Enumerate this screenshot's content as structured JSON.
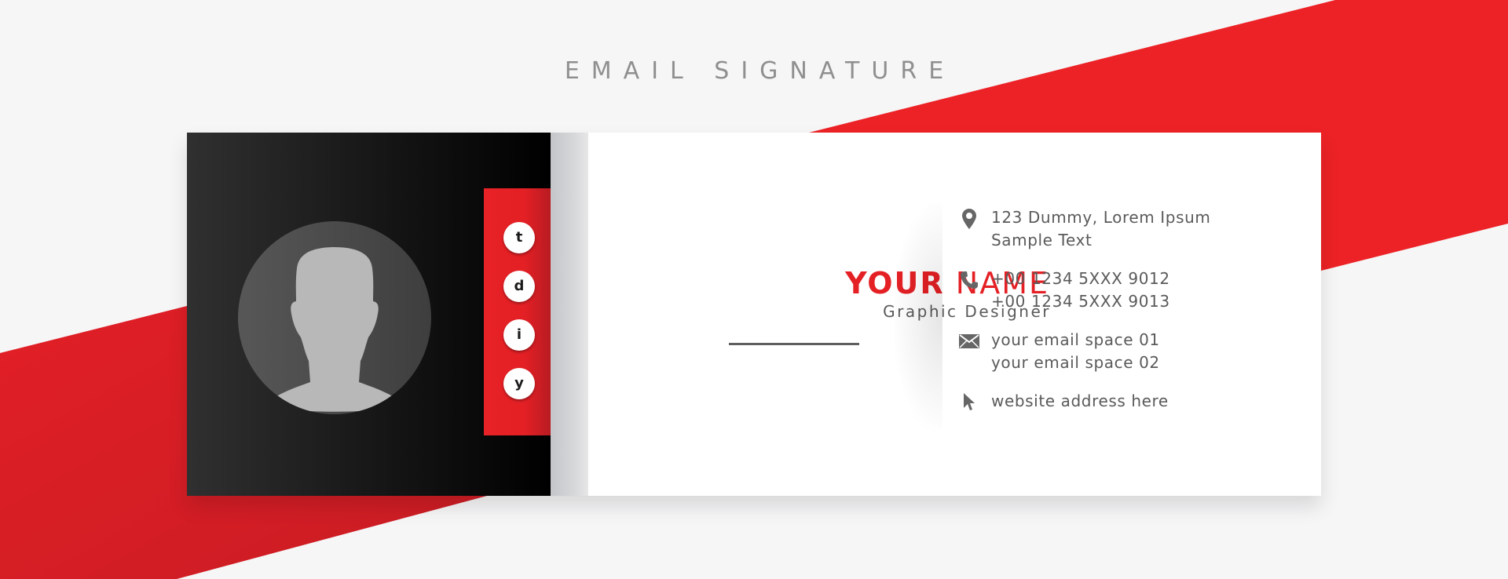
{
  "headline": "EMAIL SIGNATURE",
  "colors": {
    "accent_red": "#e42025",
    "dark_panel": "#111111",
    "text_gray": "#5a5a5a",
    "headline_gray": "#8f8f8f",
    "background": "#f6f6f7"
  },
  "profile": {
    "avatar_icon": "user-silhouette-icon",
    "first_name": "YOUR",
    "last_name": "NAME",
    "job_title": "Graphic Designer"
  },
  "social": [
    {
      "letter": "t",
      "icon": "twitter-icon"
    },
    {
      "letter": "d",
      "icon": "dribbble-icon"
    },
    {
      "letter": "i",
      "icon": "instagram-icon"
    },
    {
      "letter": "y",
      "icon": "youtube-icon"
    }
  ],
  "contacts": [
    {
      "icon": "location-pin-icon",
      "lines": [
        "123 Dummy, Lorem Ipsum",
        "Sample Text"
      ]
    },
    {
      "icon": "phone-icon",
      "lines": [
        "+00 1234 5XXX 9012",
        "+00 1234 5XXX 9013"
      ]
    },
    {
      "icon": "envelope-icon",
      "lines": [
        "your email space 01",
        "your email space 02"
      ]
    },
    {
      "icon": "cursor-icon",
      "lines": [
        "website address here"
      ]
    }
  ]
}
